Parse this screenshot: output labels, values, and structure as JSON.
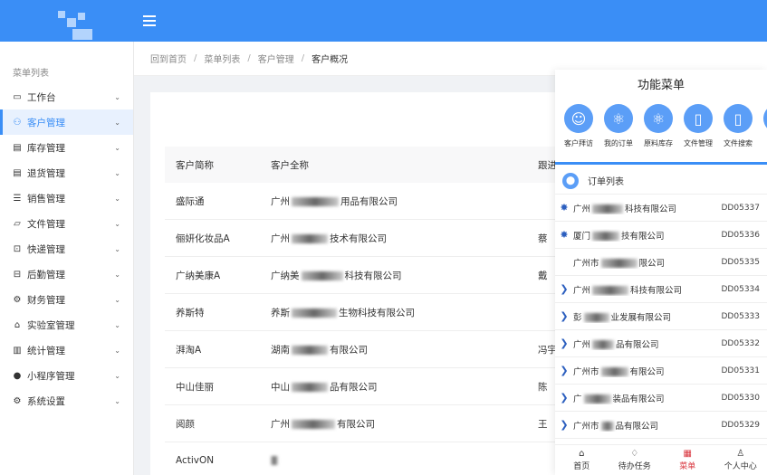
{
  "sidebar": {
    "title": "菜单列表",
    "items": [
      {
        "label": "工作台",
        "icon": "monitor-icon",
        "glyph": "▭"
      },
      {
        "label": "客户管理",
        "icon": "users-icon",
        "glyph": "⚇"
      },
      {
        "label": "库存管理",
        "icon": "doc-icon",
        "glyph": "▤"
      },
      {
        "label": "退货管理",
        "icon": "doc-icon",
        "glyph": "▤"
      },
      {
        "label": "销售管理",
        "icon": "list-icon",
        "glyph": "☰"
      },
      {
        "label": "文件管理",
        "icon": "folder-icon",
        "glyph": "▱"
      },
      {
        "label": "快递管理",
        "icon": "truck-icon",
        "glyph": "⊡"
      },
      {
        "label": "后勤管理",
        "icon": "exit-icon",
        "glyph": "⊟"
      },
      {
        "label": "财务管理",
        "icon": "gear-icon",
        "glyph": "⚙"
      },
      {
        "label": "实验室管理",
        "icon": "bank-icon",
        "glyph": "⌂"
      },
      {
        "label": "统计管理",
        "icon": "chart-icon",
        "glyph": "▥"
      },
      {
        "label": "小程序管理",
        "icon": "wechat-icon",
        "glyph": "●"
      },
      {
        "label": "系统设置",
        "icon": "settings-icon",
        "glyph": "⚙"
      }
    ]
  },
  "breadcrumb": [
    "回到首页",
    "菜单列表",
    "客户管理",
    "客户概况"
  ],
  "table": {
    "headers": [
      "客户简称",
      "客户全称",
      "跟进"
    ],
    "rows": [
      {
        "short": "盛际通",
        "full_a": "广州",
        "full_b": "用品有限公司",
        "follow": ""
      },
      {
        "short": "俪妍化妆品A",
        "full_a": "广州",
        "full_b": "技术有限公司",
        "follow": "蔡"
      },
      {
        "short": "广纳美康A",
        "full_a": "广纳美",
        "full_b": "科技有限公司",
        "follow": "戴"
      },
      {
        "short": "养斯特",
        "full_a": "养斯",
        "full_b": "生物科技有限公司",
        "follow": ""
      },
      {
        "short": "湃淘A",
        "full_a": "湖南",
        "full_b": "有限公司",
        "follow": "冯宇"
      },
      {
        "short": "中山佳丽",
        "full_a": "中山",
        "full_b": "品有限公司",
        "follow": "陈"
      },
      {
        "short": "阅颜",
        "full_a": "广州",
        "full_b": "有限公司",
        "follow": "王"
      },
      {
        "short": "ActivON",
        "full_a": "",
        "full_b": "",
        "follow": ""
      }
    ]
  },
  "panel": {
    "title": "功能菜单",
    "functions": [
      {
        "label": "客户拜访",
        "icon": "visit-icon",
        "glyph": "☺"
      },
      {
        "label": "我的订单",
        "icon": "atom-icon",
        "glyph": "⚛"
      },
      {
        "label": "原料库存",
        "icon": "atom-icon",
        "glyph": "⚛"
      },
      {
        "label": "文件管理",
        "icon": "file-icon",
        "glyph": "▯"
      },
      {
        "label": "文件搜索",
        "icon": "file-icon",
        "glyph": "▯"
      },
      {
        "label": "分",
        "icon": "more-icon",
        "glyph": "▯"
      }
    ],
    "order_title": "订单列表",
    "orders": [
      {
        "a": "广州",
        "b": "科技有限公司",
        "code": "DD05337",
        "mark": "✸"
      },
      {
        "a": "厦门",
        "b": "技有限公司",
        "code": "DD05336",
        "mark": "✸"
      },
      {
        "a": "广州市",
        "b": "限公司",
        "code": "DD05335",
        "mark": ""
      },
      {
        "a": "广州",
        "b": "科技有限公司",
        "code": "DD05334",
        "mark": "❯"
      },
      {
        "a": "彭",
        "b": "业发展有限公司",
        "code": "DD05333",
        "mark": "❯"
      },
      {
        "a": "广州",
        "b": "品有限公司",
        "code": "DD05332",
        "mark": "❯"
      },
      {
        "a": "广州市",
        "b": "有限公司",
        "code": "DD05331",
        "mark": "❯"
      },
      {
        "a": "广",
        "b": "装品有限公司",
        "code": "DD05330",
        "mark": "❯"
      },
      {
        "a": "广州市",
        "b": "品有限公司",
        "code": "DD05329",
        "mark": "❯"
      }
    ],
    "tabs": [
      {
        "label": "首页",
        "icon": "home-icon",
        "glyph": "⌂"
      },
      {
        "label": "待办任务",
        "icon": "bulb-icon",
        "glyph": "♢"
      },
      {
        "label": "菜单",
        "icon": "grid-icon",
        "glyph": "▦"
      },
      {
        "label": "个人中心",
        "icon": "user-icon",
        "glyph": "♙"
      }
    ]
  },
  "colors": {
    "accent": "#3a8ef6",
    "active_tab": "#d9363e"
  }
}
